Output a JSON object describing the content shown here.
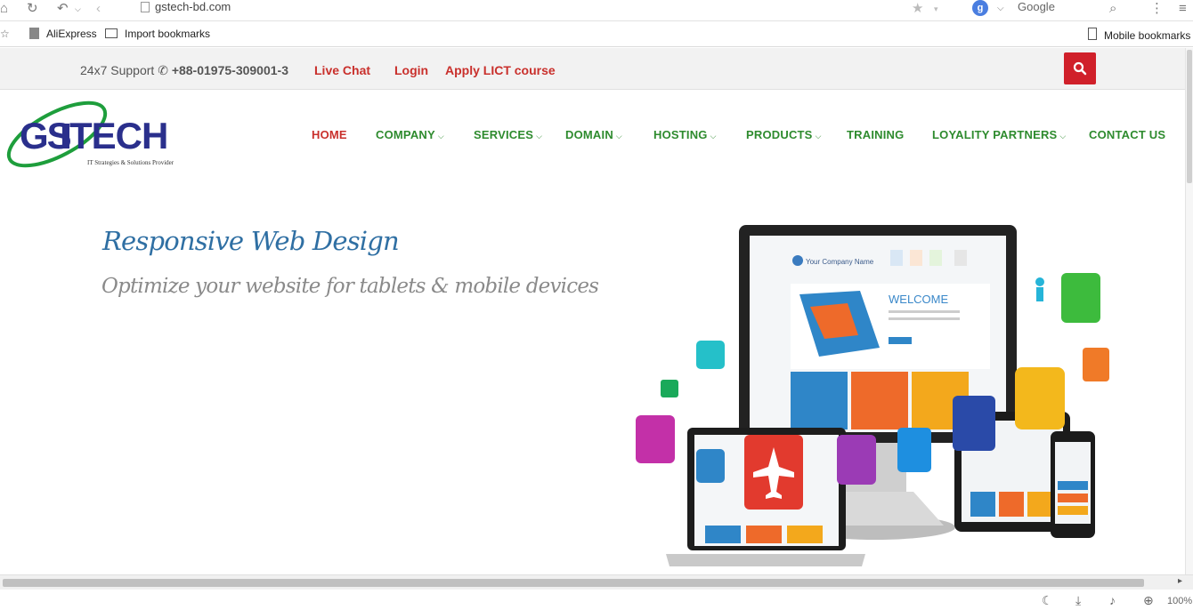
{
  "browser": {
    "url": "gstech-bd.com",
    "search_engine": "Google",
    "search_badge": "g",
    "zoom": "100%"
  },
  "bookmarks": {
    "items": [
      "AliExpress",
      "Import bookmarks"
    ],
    "mobile": "Mobile bookmarks"
  },
  "topbar": {
    "support_label": "24x7 Support",
    "support_phone": "+88-01975-309001-3",
    "live_chat": "Live Chat",
    "login": "Login",
    "apply": "Apply LICT course"
  },
  "logo": {
    "text": "GSTECH",
    "tagline": "IT Strategies & Solutions Provider"
  },
  "nav": {
    "items": [
      {
        "label": "HOME",
        "dropdown": false
      },
      {
        "label": "COMPANY",
        "dropdown": true
      },
      {
        "label": "SERVICES",
        "dropdown": true
      },
      {
        "label": "DOMAIN",
        "dropdown": true
      },
      {
        "label": "HOSTING",
        "dropdown": true
      },
      {
        "label": "PRODUCTS",
        "dropdown": true
      },
      {
        "label": "TRAINING",
        "dropdown": false
      },
      {
        "label": "LOYALITY PARTNERS",
        "dropdown": true
      },
      {
        "label": "CONTACT US",
        "dropdown": false
      }
    ],
    "caret": "⌵"
  },
  "hero": {
    "title": "Responsive Web Design",
    "subtitle": "Optimize your website for tablets & mobile devices",
    "screen_brand": "Your Company Name",
    "screen_welcome": "WELCOME"
  },
  "colors": {
    "brand_red": "#c9302c",
    "nav_green": "#2e8b2e",
    "hero_blue": "#2f6fa3"
  }
}
